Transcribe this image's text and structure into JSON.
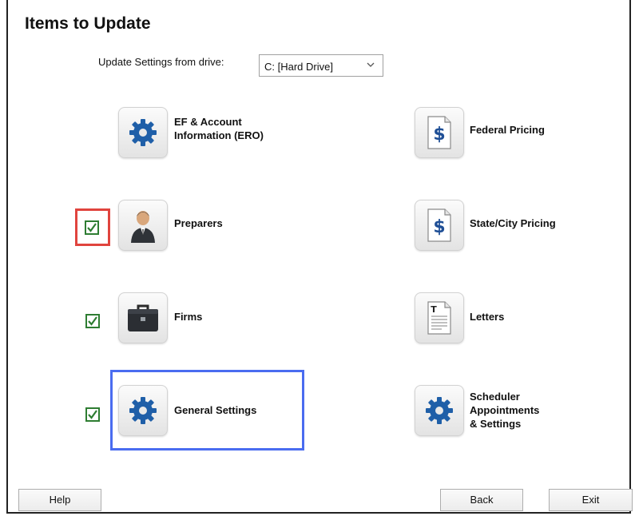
{
  "title": "Items to Update",
  "drive": {
    "label": "Update Settings from drive:",
    "selected": "C: [Hard Drive]"
  },
  "items": [
    {
      "label_lines": [
        "EF & Account",
        "Information (ERO)"
      ],
      "icon": "gear-icon",
      "checked": false
    },
    {
      "label_lines": [
        "Federal Pricing"
      ],
      "icon": "dollar-document-icon",
      "checked": false
    },
    {
      "label_lines": [
        "Preparers"
      ],
      "icon": "person-icon",
      "checked": true
    },
    {
      "label_lines": [
        "State/City Pricing"
      ],
      "icon": "dollar-document-icon",
      "checked": false
    },
    {
      "label_lines": [
        "Firms"
      ],
      "icon": "briefcase-icon",
      "checked": true
    },
    {
      "label_lines": [
        "Letters"
      ],
      "icon": "letter-document-icon",
      "checked": false
    },
    {
      "label_lines": [
        "General Settings"
      ],
      "icon": "gear-icon",
      "checked": true
    },
    {
      "label_lines": [
        "Scheduler",
        "Appointments",
        "& Settings"
      ],
      "icon": "gear-icon",
      "checked": false
    }
  ],
  "buttons": {
    "help": "Help",
    "back": "Back",
    "exit": "Exit"
  },
  "colors": {
    "gear": "#1f5fa8",
    "check": "#2e7d32",
    "focus_red": "#e0443e",
    "focus_blue": "#4a6cf0"
  }
}
